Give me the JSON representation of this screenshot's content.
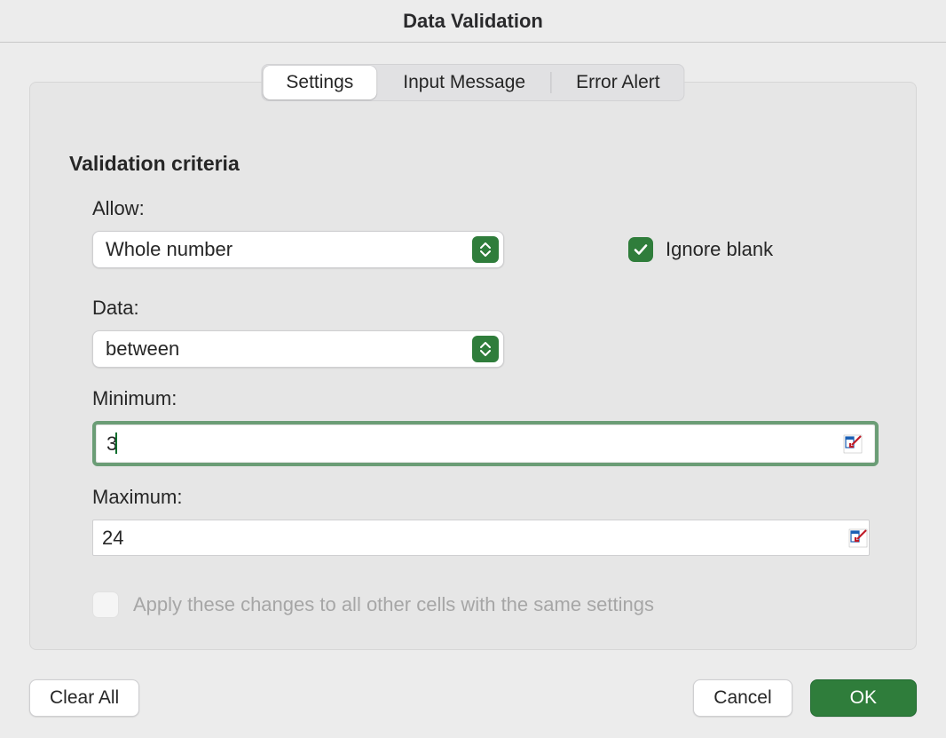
{
  "title": "Data Validation",
  "tabs": {
    "settings": "Settings",
    "input_message": "Input Message",
    "error_alert": "Error Alert",
    "active": "settings"
  },
  "section": {
    "heading": "Validation criteria"
  },
  "fields": {
    "allow_label": "Allow:",
    "allow_value": "Whole number",
    "data_label": "Data:",
    "data_value": "between",
    "minimum_label": "Minimum:",
    "minimum_value": "3",
    "maximum_label": "Maximum:",
    "maximum_value": "24"
  },
  "checkboxes": {
    "ignore_blank_label": "Ignore blank",
    "ignore_blank_checked": true,
    "apply_all_label": "Apply these changes to all other cells with the same settings",
    "apply_all_checked": false,
    "apply_all_enabled": false
  },
  "buttons": {
    "clear_all": "Clear All",
    "cancel": "Cancel",
    "ok": "OK"
  },
  "colors": {
    "accent_green": "#2f7d3b"
  }
}
